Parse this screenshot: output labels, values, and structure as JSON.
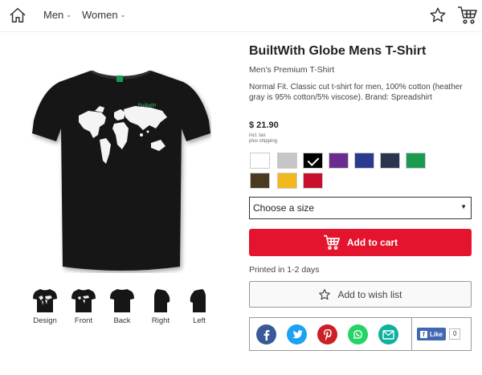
{
  "header": {
    "nav": [
      {
        "label": "Men"
      },
      {
        "label": "Women"
      }
    ]
  },
  "product": {
    "title": "BuiltWith Globe Mens T-Shirt",
    "subtitle": "Men's Premium T-Shirt",
    "description": "Normal Fit. Classic cut t-shirt for men, 100% cotton (heather gray is 95% cotton/5% viscose). Brand: Spreadshirt",
    "price": "$ 21.90",
    "tax_line1": "incl. tax",
    "tax_line2": "plus shipping",
    "shirt_tag": "Builtwith"
  },
  "colors": [
    "#ffffff",
    "#c6c6c6",
    "#000000",
    "#6a2c8e",
    "#2a3a8f",
    "#2b3550",
    "#1d9a52",
    "#4a3a22",
    "#f2b91f",
    "#c8102e"
  ],
  "selected_color_index": 2,
  "thumbnails": [
    {
      "label": "Design"
    },
    {
      "label": "Front"
    },
    {
      "label": "Back"
    },
    {
      "label": "Right"
    },
    {
      "label": "Left"
    }
  ],
  "size_select": {
    "placeholder": "Choose a size"
  },
  "add_to_cart_label": "Add to cart",
  "printed_text": "Printed in 1-2 days",
  "wishlist_label": "Add to wish list",
  "social": {
    "icons": [
      {
        "name": "facebook-icon",
        "color": "#3b5998"
      },
      {
        "name": "twitter-icon",
        "color": "#1da1f2"
      },
      {
        "name": "pinterest-icon",
        "color": "#cb2027"
      },
      {
        "name": "whatsapp-icon",
        "color": "#25d366"
      },
      {
        "name": "email-icon",
        "color": "#0fb19e"
      }
    ],
    "like_label": "Like",
    "like_count": "0"
  }
}
